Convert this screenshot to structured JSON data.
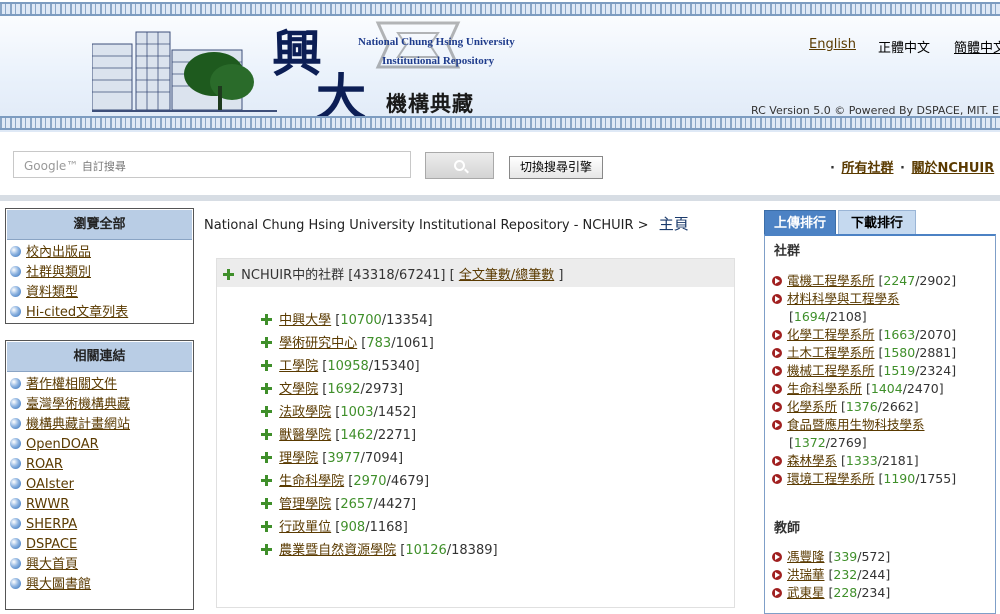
{
  "header": {
    "logo_char1": "興",
    "logo_char2": "大",
    "logo_en_line1": "National Chung Hsing University",
    "logo_en_line2": "Institutional Repository",
    "logo_zh_sub": "機構典藏",
    "languages": [
      "English",
      "正體中文",
      "簡體中文"
    ],
    "version": "RC Version 5.0 © Powered By DSPACE, MIT. E"
  },
  "search": {
    "placeholder_brand": "Google™",
    "placeholder": "自訂搜尋",
    "switch_label": "切換搜尋引擎",
    "links": [
      "所有社群",
      "關於NCHUIR"
    ]
  },
  "sidebar": {
    "browse": {
      "title": "瀏覽全部",
      "items": [
        "校內出版品",
        "社群與類別",
        "資料類型",
        "Hi-cited文章列表"
      ]
    },
    "related": {
      "title": "相關連結",
      "items": [
        "著作權相關文件",
        "臺灣學術機構典藏",
        "機構典藏計畫網站",
        "OpenDOAR",
        "ROAR",
        "OAIster",
        "RWWR",
        "SHERPA",
        "DSPACE",
        "興大首頁",
        "興大圖書館"
      ]
    }
  },
  "breadcrumb": {
    "path": "National Chung Hsing University Institutional Repository - NCHUIR >",
    "current": "主頁"
  },
  "communities": {
    "header_prefix": "NCHUIR中的社群 [43318/67241] [",
    "header_link": "全文筆數/總筆數",
    "header_suffix": "]",
    "items": [
      {
        "name": "中興大學",
        "full": "10700",
        "total": "13354"
      },
      {
        "name": "學術研究中心",
        "full": "783",
        "total": "1061"
      },
      {
        "name": "工學院",
        "full": "10958",
        "total": "15340"
      },
      {
        "name": "文學院",
        "full": "1692",
        "total": "2973"
      },
      {
        "name": "法政學院",
        "full": "1003",
        "total": "1452"
      },
      {
        "name": "獸醫學院",
        "full": "1462",
        "total": "2271"
      },
      {
        "name": "理學院",
        "full": "3977",
        "total": "7094"
      },
      {
        "name": "生命科學院",
        "full": "2970",
        "total": "4679"
      },
      {
        "name": "管理學院",
        "full": "2657",
        "total": "4427"
      },
      {
        "name": "行政單位",
        "full": "908",
        "total": "1168"
      },
      {
        "name": "農業暨自然資源學院",
        "full": "10126",
        "total": "18389"
      }
    ]
  },
  "ranking": {
    "tabs": [
      "上傳排行",
      "下載排行"
    ],
    "sections": [
      {
        "title": "社群",
        "items": [
          {
            "name": "電機工程學系所",
            "full": "2247",
            "total": "2902"
          },
          {
            "name": "材料科學與工程學系",
            "full": "1694",
            "total": "2108"
          },
          {
            "name": "化學工程學系所",
            "full": "1663",
            "total": "2070"
          },
          {
            "name": "土木工程學系所",
            "full": "1580",
            "total": "2881"
          },
          {
            "name": "機械工程學系所",
            "full": "1519",
            "total": "2324"
          },
          {
            "name": "生命科學系所",
            "full": "1404",
            "total": "2470"
          },
          {
            "name": "化學系所",
            "full": "1376",
            "total": "2662"
          },
          {
            "name": "食品暨應用生物科技學系",
            "full": "1372",
            "total": "2769"
          },
          {
            "name": "森林學系",
            "full": "1333",
            "total": "2181"
          },
          {
            "name": "環境工程學系所",
            "full": "1190",
            "total": "1755"
          }
        ]
      },
      {
        "title": "教師",
        "items": [
          {
            "name": "馮豐隆",
            "full": "339",
            "total": "572"
          },
          {
            "name": "洪瑞華",
            "full": "232",
            "total": "244"
          },
          {
            "name": "武東星",
            "full": "228",
            "total": "234"
          }
        ]
      }
    ]
  },
  "colors": {
    "accent": "#4c82c4",
    "link": "#5a3a00",
    "count": "#3f8f2a",
    "header_bg": "#dfe9f6"
  }
}
